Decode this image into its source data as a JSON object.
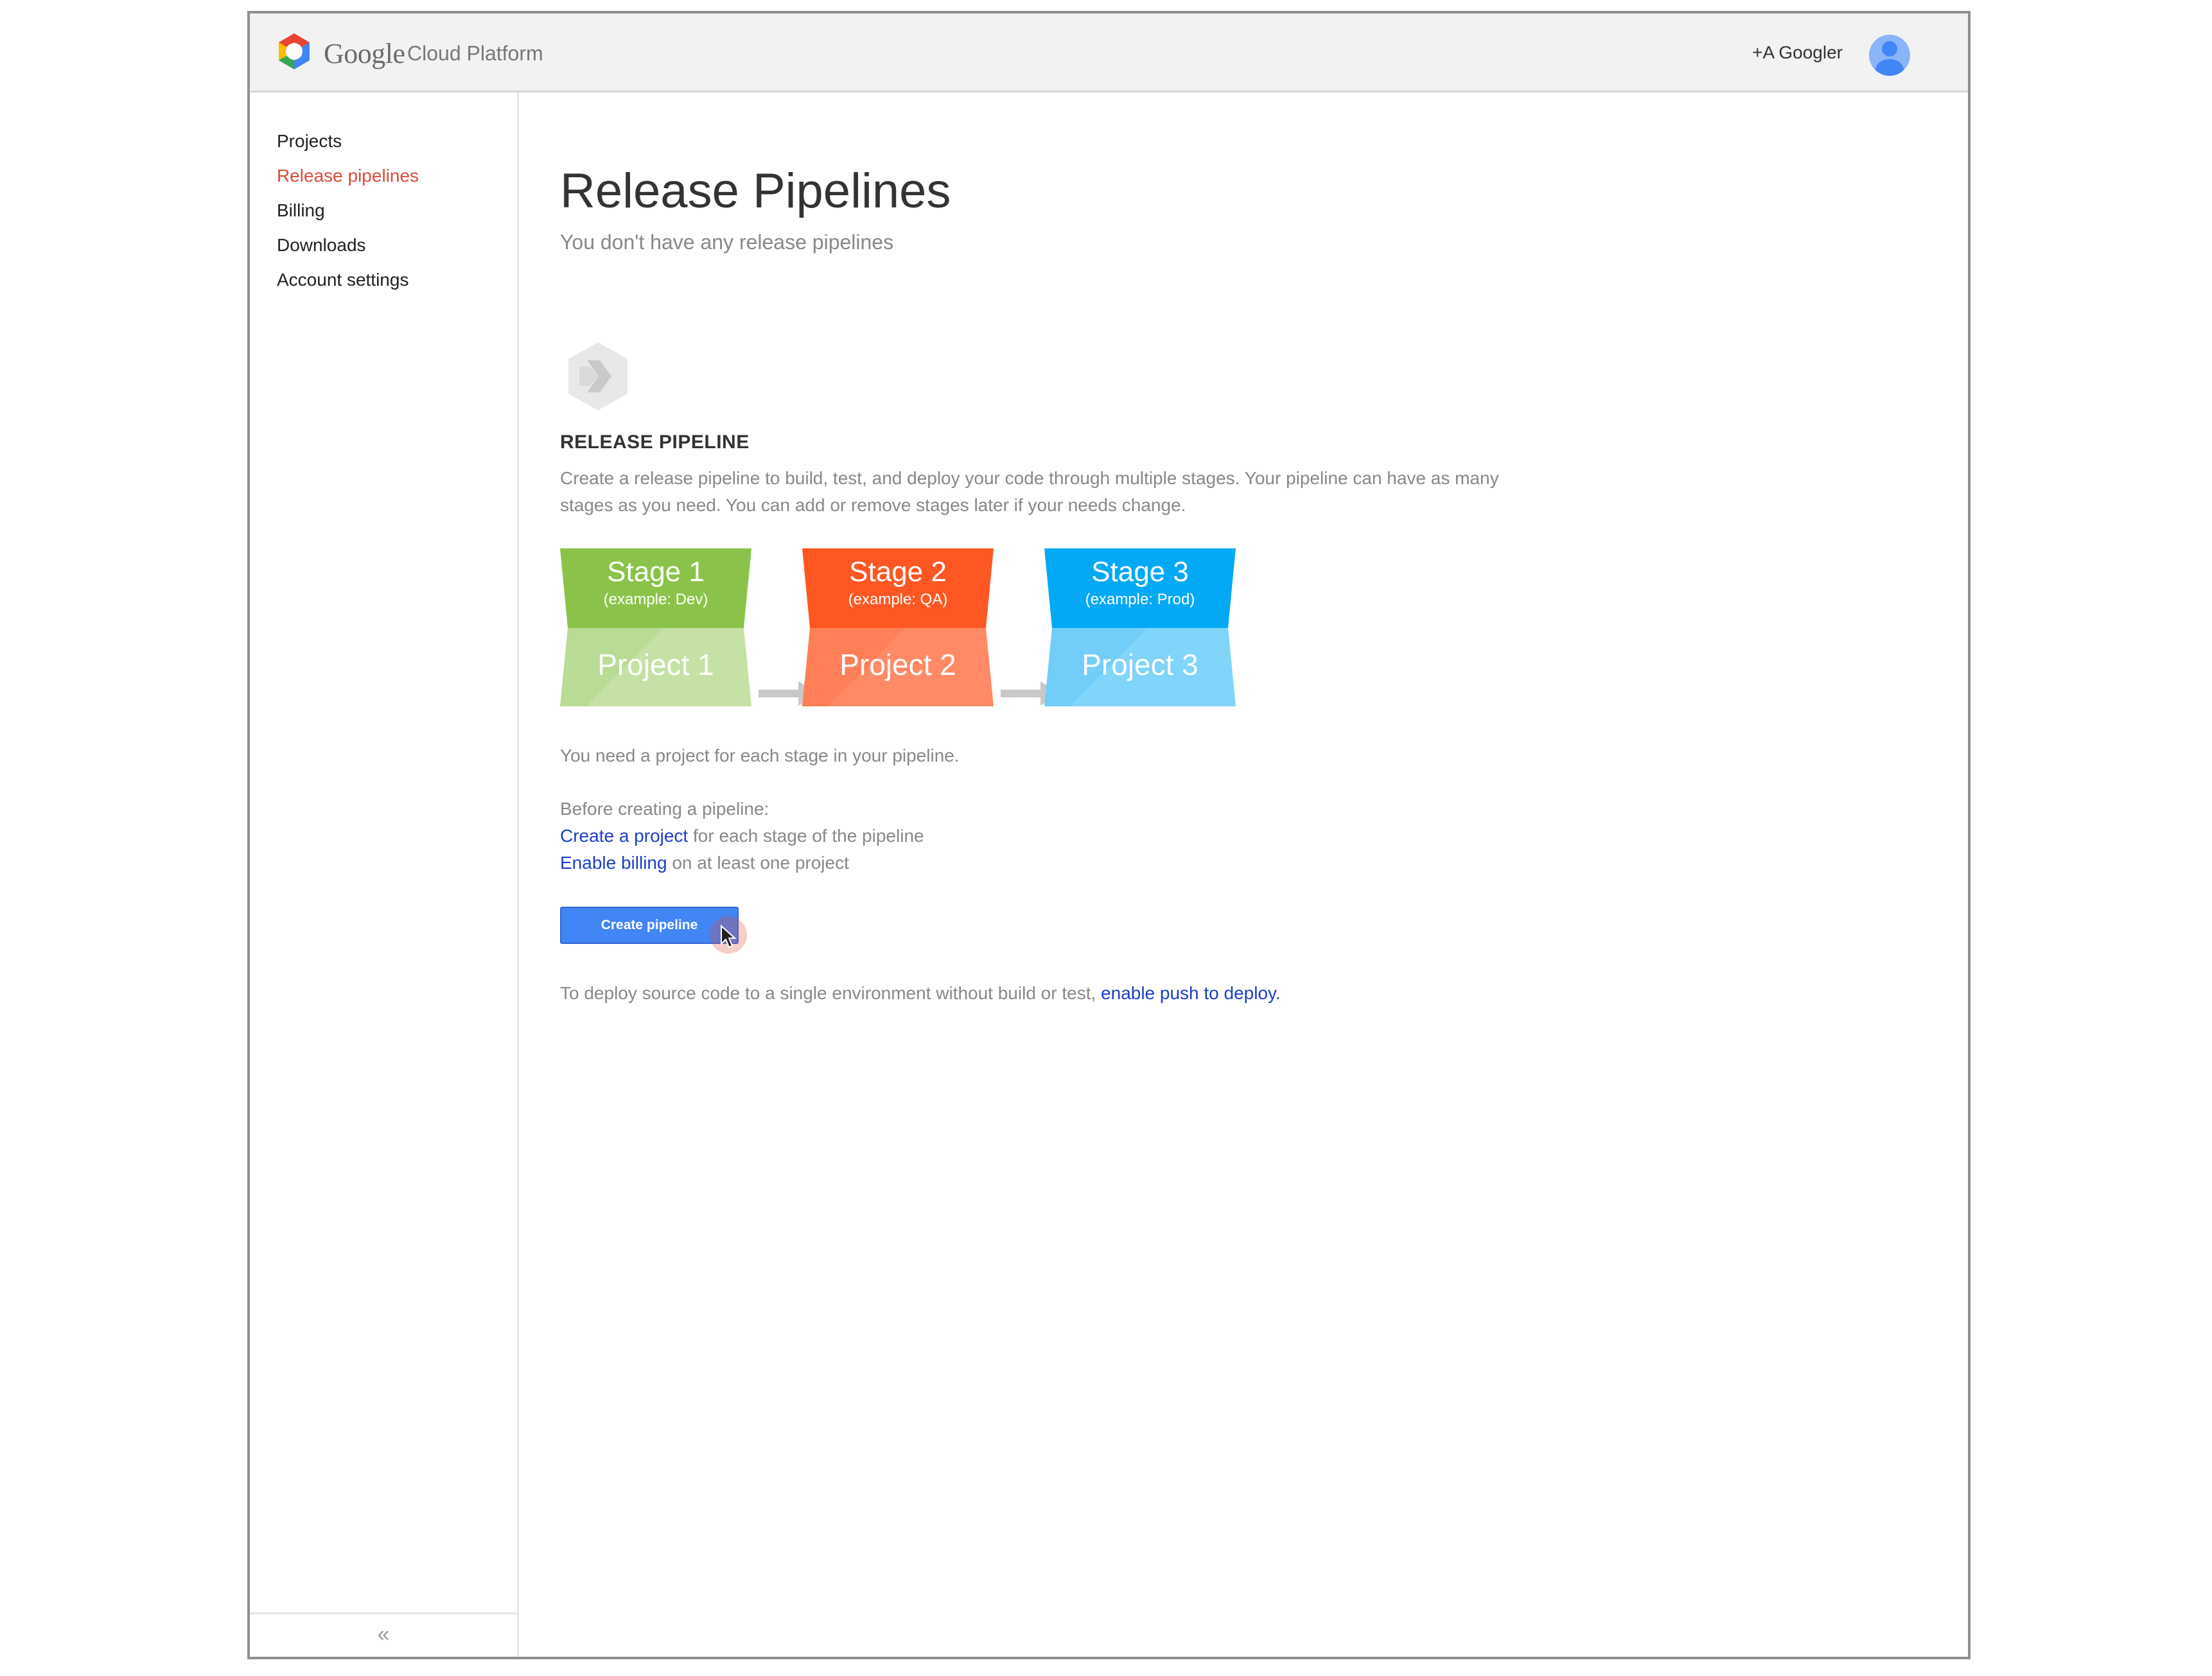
{
  "header": {
    "logo_google": "Google",
    "logo_product": "Cloud Platform",
    "user": "+A Googler"
  },
  "sidebar": {
    "items": [
      {
        "label": "Projects",
        "active": false
      },
      {
        "label": "Release pipelines",
        "active": true
      },
      {
        "label": "Billing",
        "active": false
      },
      {
        "label": "Downloads",
        "active": false
      },
      {
        "label": "Account settings",
        "active": false
      }
    ],
    "collapse_label": "«"
  },
  "main": {
    "title": "Release Pipelines",
    "subtitle": "You don't have any release pipelines",
    "section_heading": "RELEASE PIPELINE",
    "description": "Create a release pipeline to build, test, and deploy your code through multiple stages. Your pipeline can have as many stages as you need. You can add or remove stages later if your needs change.",
    "stages": [
      {
        "name": "Stage 1",
        "example": "(example: Dev)",
        "project": "Project 1",
        "color_top": "#8bc34a",
        "color_bottom": "#c5e1a5"
      },
      {
        "name": "Stage 2",
        "example": "(example: QA)",
        "project": "Project 2",
        "color_top": "#ff5722",
        "color_bottom": "#ff8a65"
      },
      {
        "name": "Stage 3",
        "example": "(example: Prod)",
        "project": "Project 3",
        "color_top": "#03a9f4",
        "color_bottom": "#81d4fa"
      }
    ],
    "need_project": "You need a project for each stage in your pipeline.",
    "before_heading": "Before creating a pipeline:",
    "step1_link": "Create a project",
    "step1_text": " for each stage of the pipeline",
    "step2_link": "Enable billing",
    "step2_text": " on at least one project",
    "create_button": "Create pipeline",
    "footer_text": "To deploy source code to a single environment without build or test, ",
    "footer_link": "enable push to deploy."
  },
  "colors": {
    "accent": "#4285f4",
    "active_nav": "#dd4b39",
    "link": "#1a3ec9"
  }
}
